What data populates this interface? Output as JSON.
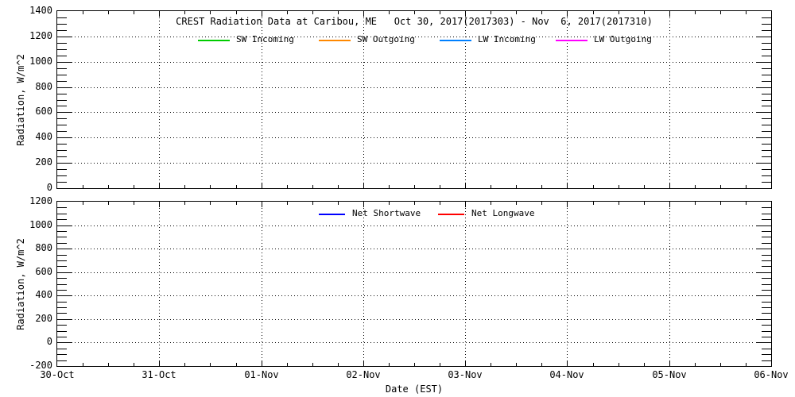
{
  "figure": {
    "title": "CREST Radiation Data at Caribou, ME   Oct 30, 2017(2017303) - Nov  6, 2017(2017310)",
    "background_color": "#ffffff",
    "axis_color": "#000000"
  },
  "x_axis": {
    "title": "Date (EST)",
    "tick_labels": [
      "30-Oct",
      "31-Oct",
      "01-Nov",
      "02-Nov",
      "03-Nov",
      "04-Nov",
      "05-Nov",
      "06-Nov"
    ],
    "minor_ticks_per_day": 4,
    "gridlines": "dotted vertical line at each day tick"
  },
  "chart_data": [
    {
      "type": "line",
      "panel": "top",
      "ylabel": "Radiation, W/m^2",
      "ylim": [
        0,
        1400
      ],
      "yticks": [
        1400,
        1200,
        1000,
        800,
        600,
        400,
        200,
        0
      ],
      "yminor_step": 50,
      "grid": "dotted horizontal line at each 200 W/m^2",
      "legend_position": "top inside",
      "series": [
        {
          "name": "SW Incoming",
          "color": "#00cc00",
          "x": [],
          "y": []
        },
        {
          "name": "SW Outgoing",
          "color": "#ff8800",
          "x": [],
          "y": []
        },
        {
          "name": "LW Incoming",
          "color": "#0080ff",
          "x": [],
          "y": []
        },
        {
          "name": "LW Outgoing",
          "color": "#ff00ff",
          "x": [],
          "y": []
        }
      ],
      "data_note": "axes are empty - no data traces plotted for this period"
    },
    {
      "type": "line",
      "panel": "bottom",
      "ylabel": "Radiation, W/m^2",
      "ylim": [
        -200,
        1200
      ],
      "yticks": [
        1200,
        1000,
        800,
        600,
        400,
        200,
        0,
        -200
      ],
      "yminor_step": 50,
      "grid": "dotted horizontal line at each 200 W/m^2",
      "legend_position": "top inside",
      "series": [
        {
          "name": "Net Shortwave",
          "color": "#0000ff",
          "x": [],
          "y": []
        },
        {
          "name": "Net Longwave",
          "color": "#ff0000",
          "x": [],
          "y": []
        }
      ],
      "data_note": "axes are empty - no data traces plotted for this period"
    }
  ]
}
